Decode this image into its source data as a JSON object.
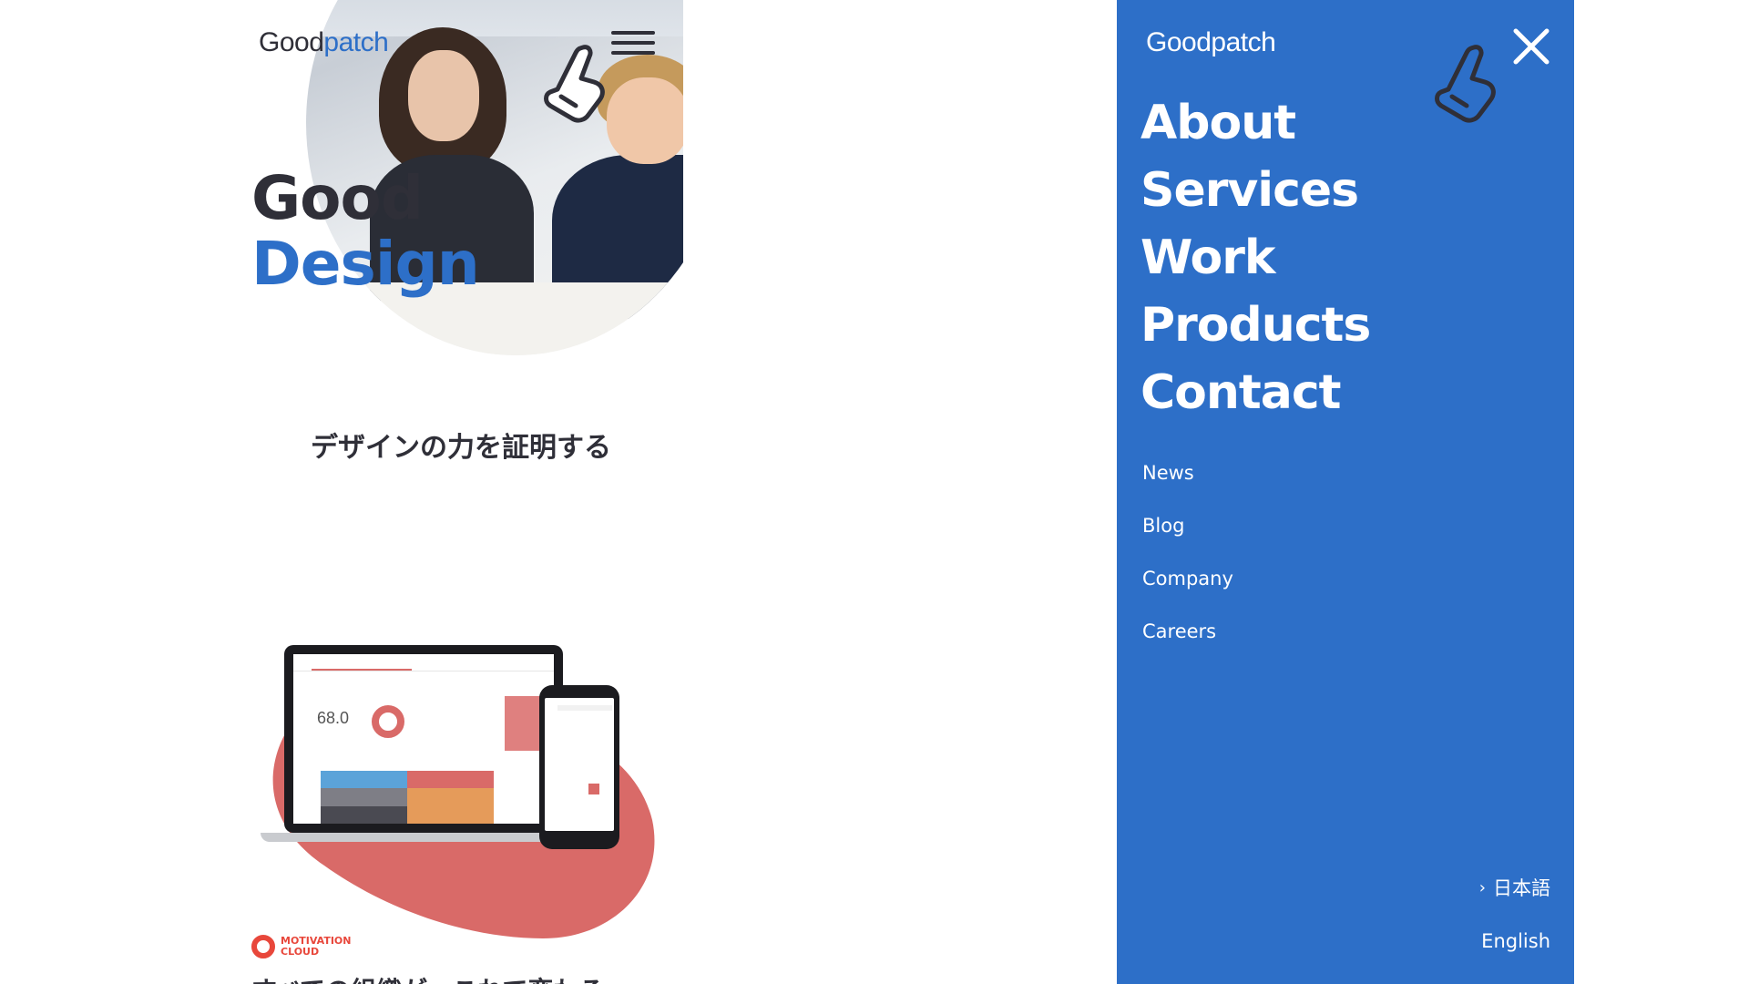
{
  "left_page": {
    "logo_text_left": "Good",
    "logo_text_right": "patch",
    "headline_line1": "Good",
    "headline_line2": "Design",
    "tagline": "デザインの力を証明する",
    "product": {
      "score": "68.0",
      "brand_line1": "MOTIVATION",
      "brand_line2": "CLOUD",
      "caption": "すべての組織が、これで変わる"
    }
  },
  "menu": {
    "logo_text_left": "Good",
    "logo_text_right": "patch",
    "main_items": [
      "About",
      "Services",
      "Work",
      "Products",
      "Contact"
    ],
    "sub_items": [
      "News",
      "Blog",
      "Company",
      "Careers"
    ],
    "languages": [
      {
        "label": "日本語",
        "chevron": "›"
      },
      {
        "label": "English",
        "chevron": ""
      }
    ]
  },
  "colors": {
    "brand_blue": "#2d6fc8",
    "dark_text": "#2f2f38",
    "coral": "#d96a68",
    "motivation_red": "#e8473b"
  },
  "icons": [
    "pointer-hand-icon",
    "hamburger-menu-icon",
    "close-icon",
    "chevron-right-icon"
  ]
}
